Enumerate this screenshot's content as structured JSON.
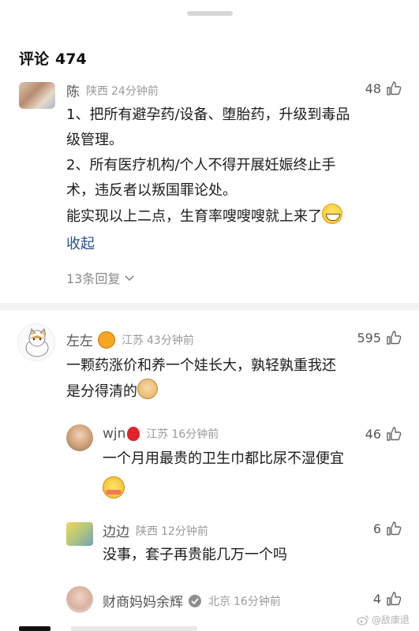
{
  "header": {
    "label": "评论",
    "count": "474"
  },
  "comments": [
    {
      "name": "陈",
      "location": "陕西",
      "time": "24分钟前",
      "likes": "48",
      "lines": [
        "1、把所有避孕药/设备、堕胎药，升级到毒品",
        "级管理。",
        "2、所有医疗机构/个人不得开展妊娠终止手",
        "术，违反者以叛国罪论处。",
        "能实现以上二点，生育率嗖嗖嗖就上来了"
      ],
      "collapse": "收起",
      "replies": "13条回复"
    },
    {
      "name": "左左",
      "location": "江苏",
      "time": "43分钟前",
      "likes": "595",
      "lines": [
        "一颗药涨价和养一个娃长大，孰轻孰重我还",
        "是分得清的"
      ]
    }
  ],
  "replies": [
    {
      "name": "wjn",
      "location": "江苏",
      "time": "16分钟前",
      "likes": "46",
      "text": "一个月用最贵的卫生巾都比尿不湿便宜"
    },
    {
      "name": "边边",
      "location": "陕西",
      "time": "12分钟前",
      "likes": "6",
      "text": "没事，套子再贵能几万一个吗"
    },
    {
      "name": "财商妈妈余辉",
      "location": "北京",
      "time": "16分钟前",
      "likes": "4"
    }
  ],
  "watermark": "@敌康退"
}
